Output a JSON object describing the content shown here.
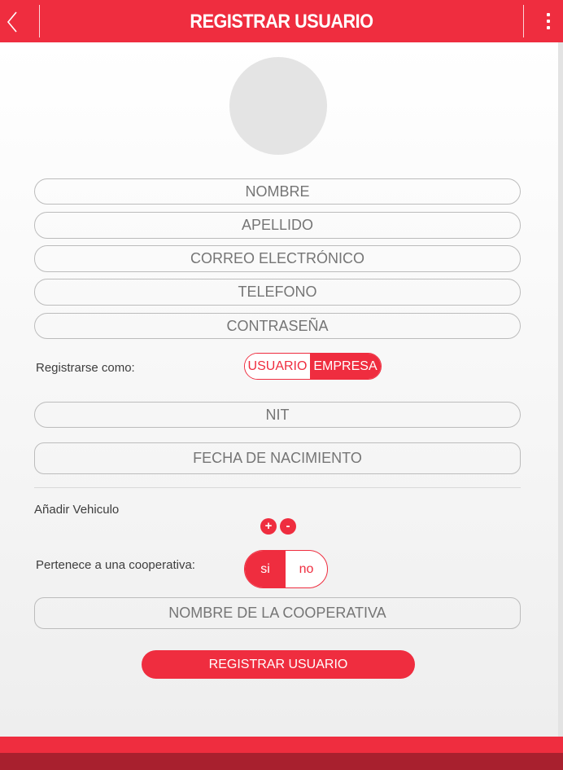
{
  "header": {
    "title": "REGISTRAR USUARIO",
    "back_icon": "chevron-left-icon",
    "menu_icon": "more-vertical-icon"
  },
  "form": {
    "fields": {
      "nombre": "NOMBRE",
      "apellido": "APELLIDO",
      "correo": "CORREO ELECTRÓNICO",
      "telefono": "TELEFONO",
      "contrasena": "CONTRASEÑA",
      "nit": "NIT",
      "fecha_nacimiento": "FECHA DE NACIMIENTO",
      "nombre_cooperativa": "NOMBRE DE LA COOPERATIVA"
    },
    "register_as": {
      "label": "Registrarse como:",
      "options": [
        "USUARIO",
        "EMPRESA"
      ],
      "selected": "EMPRESA"
    },
    "vehicle": {
      "label": "Añadir Vehiculo",
      "add_symbol": "+",
      "remove_symbol": "-"
    },
    "cooperative": {
      "label": "Pertenece a una cooperativa:",
      "options": [
        "si",
        "no"
      ],
      "selected": "si"
    },
    "submit_label": "REGISTRAR USUARIO"
  },
  "colors": {
    "accent": "#ef2d3f",
    "accent_dark": "#a8202e",
    "placeholder": "#b3b3b3",
    "border": "#bcbcbc"
  }
}
